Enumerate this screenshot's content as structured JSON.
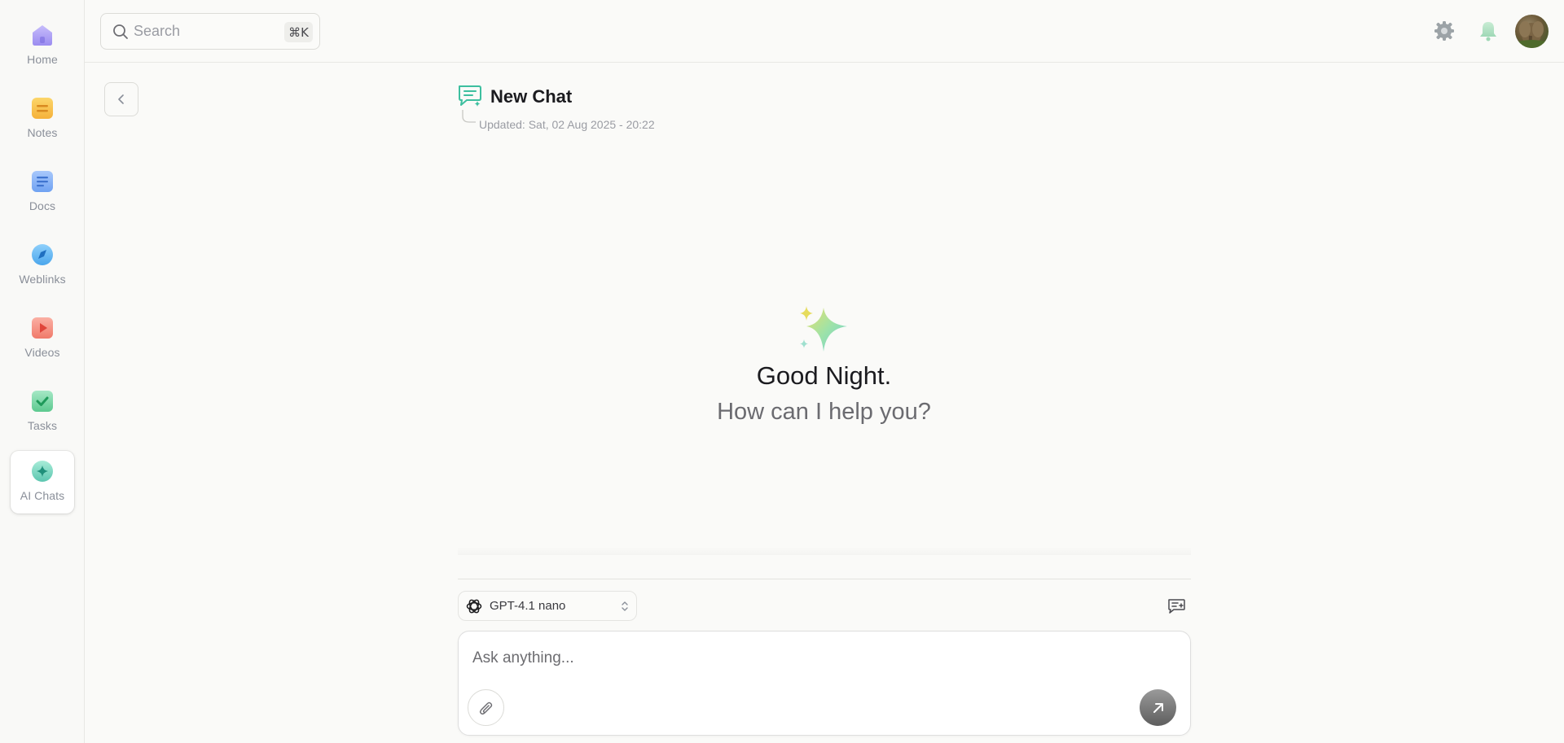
{
  "sidebar": {
    "items": [
      {
        "label": "Home",
        "icon": "home-icon",
        "color": "#9b8cf0"
      },
      {
        "label": "Notes",
        "icon": "notes-icon",
        "color": "#f7c24a"
      },
      {
        "label": "Docs",
        "icon": "docs-icon",
        "color": "#6fa2f2"
      },
      {
        "label": "Weblinks",
        "icon": "weblinks-icon",
        "color": "#5bb3f0"
      },
      {
        "label": "Videos",
        "icon": "videos-icon",
        "color": "#f07a6a"
      },
      {
        "label": "Tasks",
        "icon": "tasks-icon",
        "color": "#4fc28a"
      },
      {
        "label": "AI Chats",
        "icon": "ai-chats-icon",
        "color": "#5cc6b0",
        "active": true
      }
    ]
  },
  "topbar": {
    "search_placeholder": "Search",
    "search_shortcut": "⌘K",
    "icons": [
      "settings-icon",
      "bell-icon",
      "avatar"
    ]
  },
  "chat": {
    "title": "New Chat",
    "updated": "Updated: Sat, 02 Aug 2025 - 20:22",
    "greeting": "Good Night.",
    "subgreeting": "How can I help you?"
  },
  "composer": {
    "model": "GPT-4.1 nano",
    "placeholder": "Ask anything..."
  },
  "colors": {
    "accent": "#3dbf9f",
    "background": "#fafaf8"
  }
}
